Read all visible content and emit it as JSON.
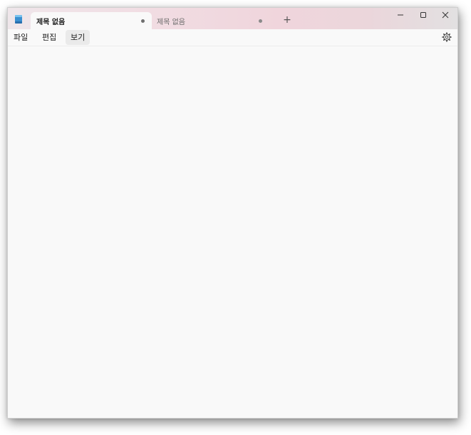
{
  "app": {
    "icon": "notepad-icon",
    "accent_color": "#3a8fd0"
  },
  "tabs": [
    {
      "title": "제목 없음",
      "active": true,
      "modified": true
    },
    {
      "title": "제목 없음",
      "active": false,
      "modified": true
    }
  ],
  "new_tab": {
    "label": "+"
  },
  "caption_buttons": {
    "minimize": "minimize-icon",
    "maximize": "maximize-icon",
    "close": "close-icon"
  },
  "menu": {
    "file": "파일",
    "edit": "편집",
    "view": "보기"
  },
  "settings": {
    "icon": "gear-icon"
  },
  "editor": {
    "content": ""
  }
}
